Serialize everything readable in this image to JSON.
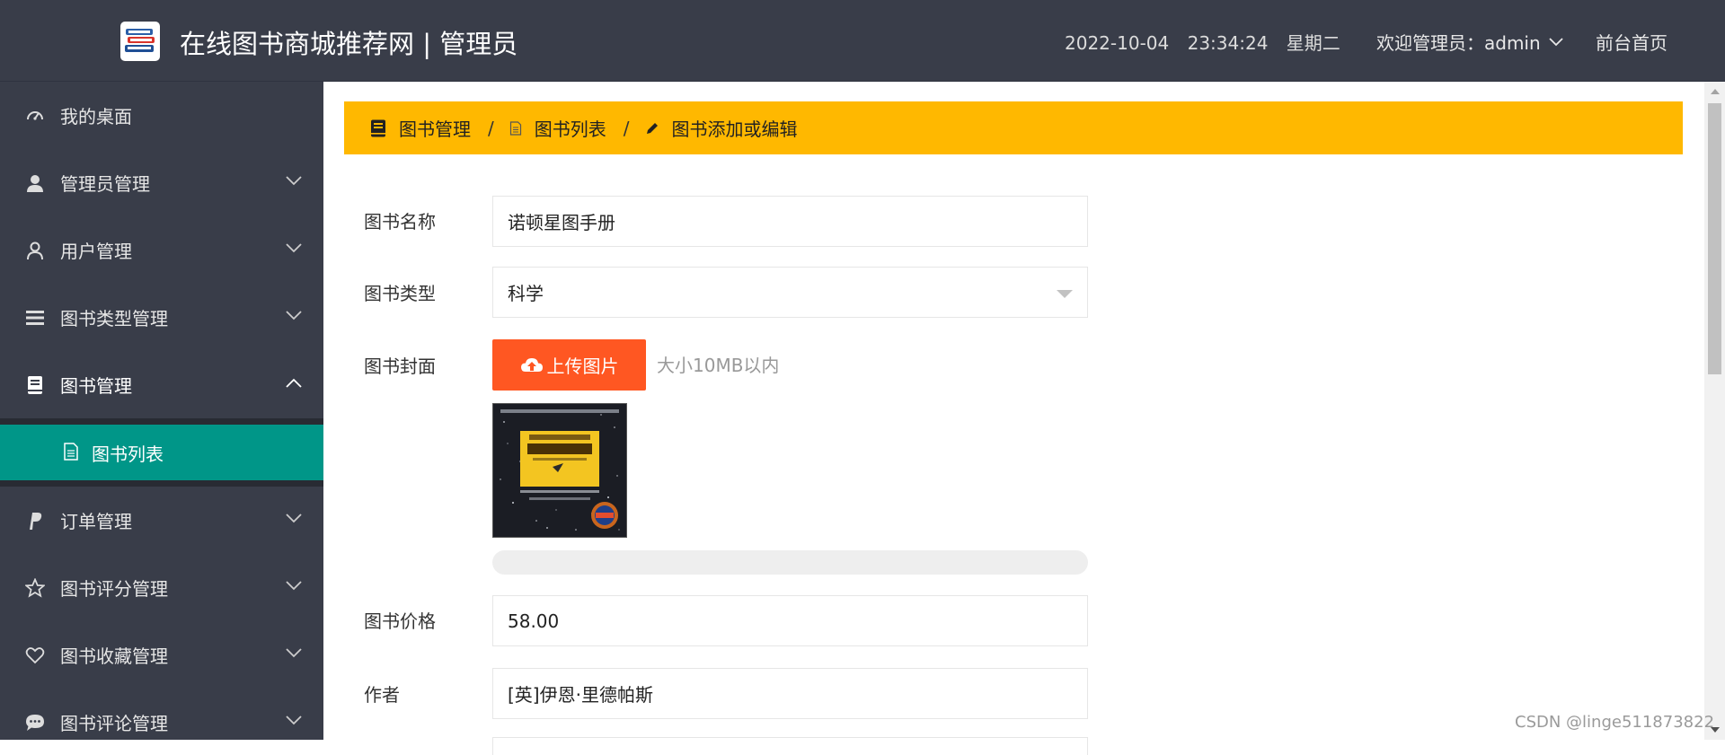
{
  "header": {
    "title": "在线图书商城推荐网 | 管理员",
    "date": "2022-10-04",
    "time": "23:34:24",
    "weekday": "星期二",
    "welcome": "欢迎管理员：admin",
    "front_link": "前台首页",
    "logo_icon": "books-logo-icon"
  },
  "sidebar": {
    "items": [
      {
        "label": "我的桌面",
        "icon": "dashboard-icon"
      },
      {
        "label": "管理员管理",
        "icon": "user-solid-icon"
      },
      {
        "label": "用户管理",
        "icon": "user-outline-icon"
      },
      {
        "label": "图书类型管理",
        "icon": "list-icon"
      },
      {
        "label": "图书管理",
        "icon": "book-icon",
        "open": true
      },
      {
        "label": "订单管理",
        "icon": "paypal-icon"
      },
      {
        "label": "图书评分管理",
        "icon": "star-icon"
      },
      {
        "label": "图书收藏管理",
        "icon": "heart-icon"
      },
      {
        "label": "图书评论管理",
        "icon": "comment-icon"
      }
    ],
    "sub_item": {
      "label": "图书列表",
      "icon": "document-icon"
    }
  },
  "breadcrumb": {
    "items": [
      "图书管理",
      "图书列表",
      "图书添加或编辑"
    ],
    "separator": "/"
  },
  "form": {
    "name_label": "图书名称",
    "name_value": "诺顿星图手册",
    "type_label": "图书类型",
    "type_value": "科学",
    "cover_label": "图书封面",
    "upload_label": "上传图片",
    "upload_hint": "大小10MB以内",
    "upload_progress": 0,
    "price_label": "图书价格",
    "price_value": "58.00",
    "author_label": "作者",
    "author_value": "[英]伊恩·里德帕斯"
  },
  "watermark": "CSDN @linge511873822",
  "colors": {
    "header_bg": "#393d49",
    "active_sub": "#009688",
    "breadcrumb_bg": "#ffb800",
    "upload_btn": "#ff5722"
  }
}
